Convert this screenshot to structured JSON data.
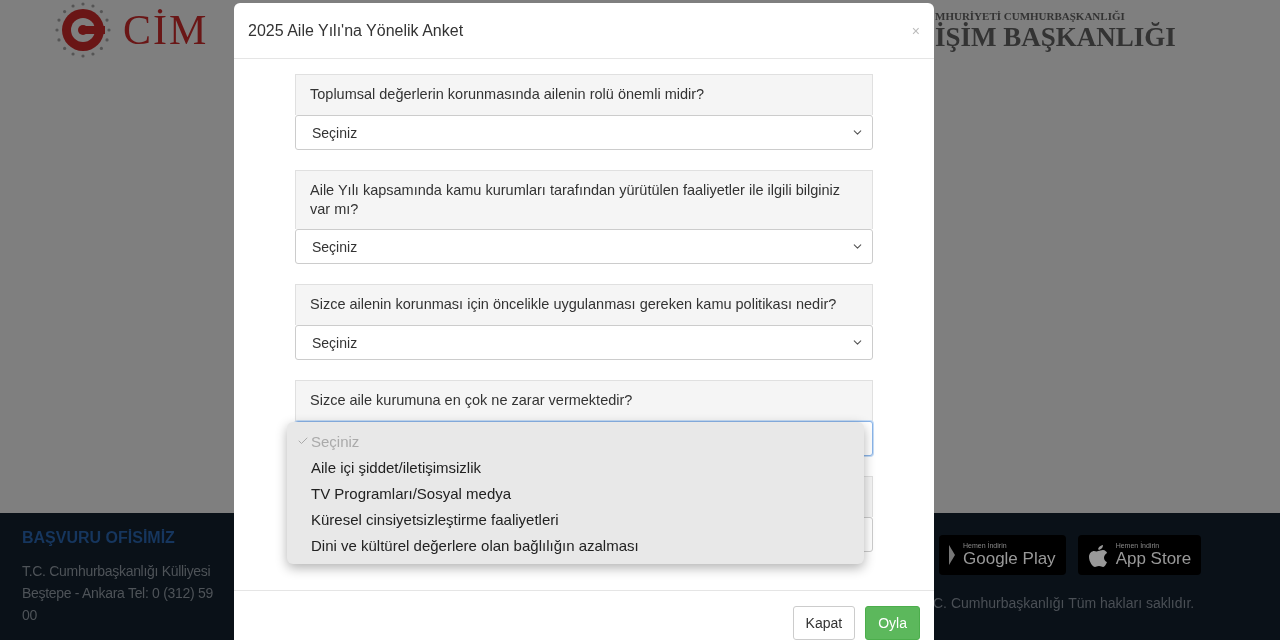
{
  "header": {
    "logo_text": "CİM",
    "org_line_small": "MHURİYETİ CUMHURBAŞKANLIĞI",
    "org_line_large": "İŞİM BAŞKANLIĞI"
  },
  "footer": {
    "heading": "BAŞVURU OFİSİMİZ",
    "address_lines": [
      "T.C. Cumhurbaşkanlığı Külliyesi",
      "Beştepe - Ankara Tel: 0 (312) 59",
      "00"
    ],
    "store_badges": [
      {
        "kind": "google",
        "caption": "Hemen İndirin",
        "store": "Google Play"
      },
      {
        "kind": "apple",
        "caption": "Hemen İndirin",
        "store": "App Store"
      }
    ],
    "copyright": "C. Cumhurbaşkanlığı Tüm hakları saklıdır."
  },
  "modal": {
    "title": "2025 Aile Yılı'na Yönelik Anket",
    "close": "×",
    "questions": [
      {
        "label": "Toplumsal değerlerin korunmasında ailenin rolü önemli midir?",
        "value": "Seçiniz",
        "open": false
      },
      {
        "label": "Aile Yılı kapsamında kamu kurumları tarafından yürütülen faaliyetler ile ilgili bilginiz var mı?",
        "value": "Seçiniz",
        "open": false
      },
      {
        "label": "Sizce ailenin korunması için öncelikle uygulanması gereken kamu politikası nedir?",
        "value": "Seçiniz",
        "open": false
      },
      {
        "label": "Sizce aile kurumuna en çok ne zarar vermektedir?",
        "open": true,
        "options": [
          {
            "label": "Seçiniz",
            "selected": true
          },
          {
            "label": "Aile içi şiddet/iletişimsizlik",
            "selected": false
          },
          {
            "label": "TV Programları/Sosyal medya",
            "selected": false
          },
          {
            "label": "Küresel cinsiyetsizleştirme faaliyetleri",
            "selected": false
          },
          {
            "label": "Dini ve kültürel değerlere olan bağlılığın azalması",
            "selected": false
          }
        ]
      },
      {
        "open": false
      }
    ],
    "buttons": [
      {
        "kind": "default",
        "label": "Kapat"
      },
      {
        "kind": "primary",
        "label": "Oyla"
      }
    ]
  }
}
